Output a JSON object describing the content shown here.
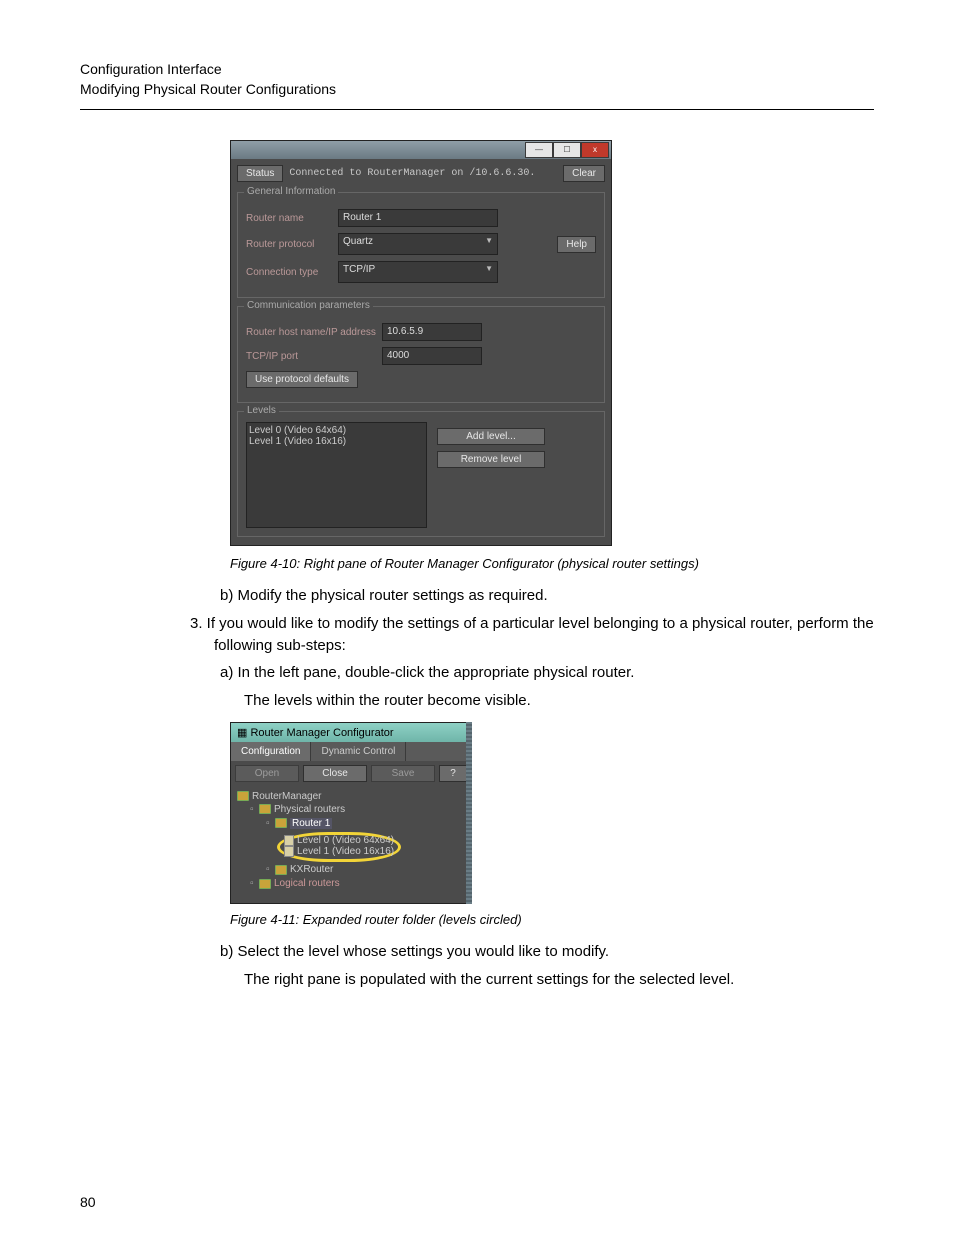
{
  "header": {
    "line1": "Configuration Interface",
    "line2": "Modifying Physical Router Configurations"
  },
  "figure1": {
    "status_label": "Status",
    "status_text": "Connected to RouterManager on /10.6.6.30.",
    "clear": "Clear",
    "group_general": "General Information",
    "router_name_label": "Router name",
    "router_name_value": "Router 1",
    "router_protocol_label": "Router protocol",
    "router_protocol_value": "Quartz",
    "help": "Help",
    "conn_type_label": "Connection type",
    "conn_type_value": "TCP/IP",
    "group_comm": "Communication parameters",
    "host_label": "Router host name/IP address",
    "host_value": "10.6.5.9",
    "port_label": "TCP/IP port",
    "port_value": "4000",
    "defaults_btn": "Use protocol defaults",
    "group_levels": "Levels",
    "level0": "Level 0 (Video 64x64)",
    "level1": "Level 1 (Video 16x16)",
    "add_level": "Add level...",
    "remove_level": "Remove level",
    "caption": "Figure 4-10:  Right pane of Router Manager Configurator (physical router settings)"
  },
  "steps": {
    "b1": "b)   Modify the physical router settings as required.",
    "s3": "3.   If you would like to modify the settings of a particular level belonging to a physical router, perform the following sub-steps:",
    "a1": "a)   In the left pane, double-click the appropriate physical router.",
    "a1_cont": "The levels within the router become visible.",
    "b2": "b)   Select the level whose settings you would like to modify.",
    "b2_cont": "The right pane is populated with the current settings for the selected level."
  },
  "figure2": {
    "title": "Router Manager Configurator",
    "tab_config": "Configuration",
    "tab_dynamic": "Dynamic Control",
    "btn_open": "Open",
    "btn_close": "Close",
    "btn_save": "Save",
    "btn_help": "?",
    "tree_root": "RouterManager",
    "tree_phys": "Physical routers",
    "tree_router1": "Router 1",
    "tree_l0": "Level 0 (Video 64x64)",
    "tree_l1": "Level 1 (Video 16x16)",
    "tree_kx": "KXRouter",
    "tree_logical": "Logical routers",
    "caption": "Figure 4-11:  Expanded router folder (levels circled)"
  },
  "page_number": "80"
}
